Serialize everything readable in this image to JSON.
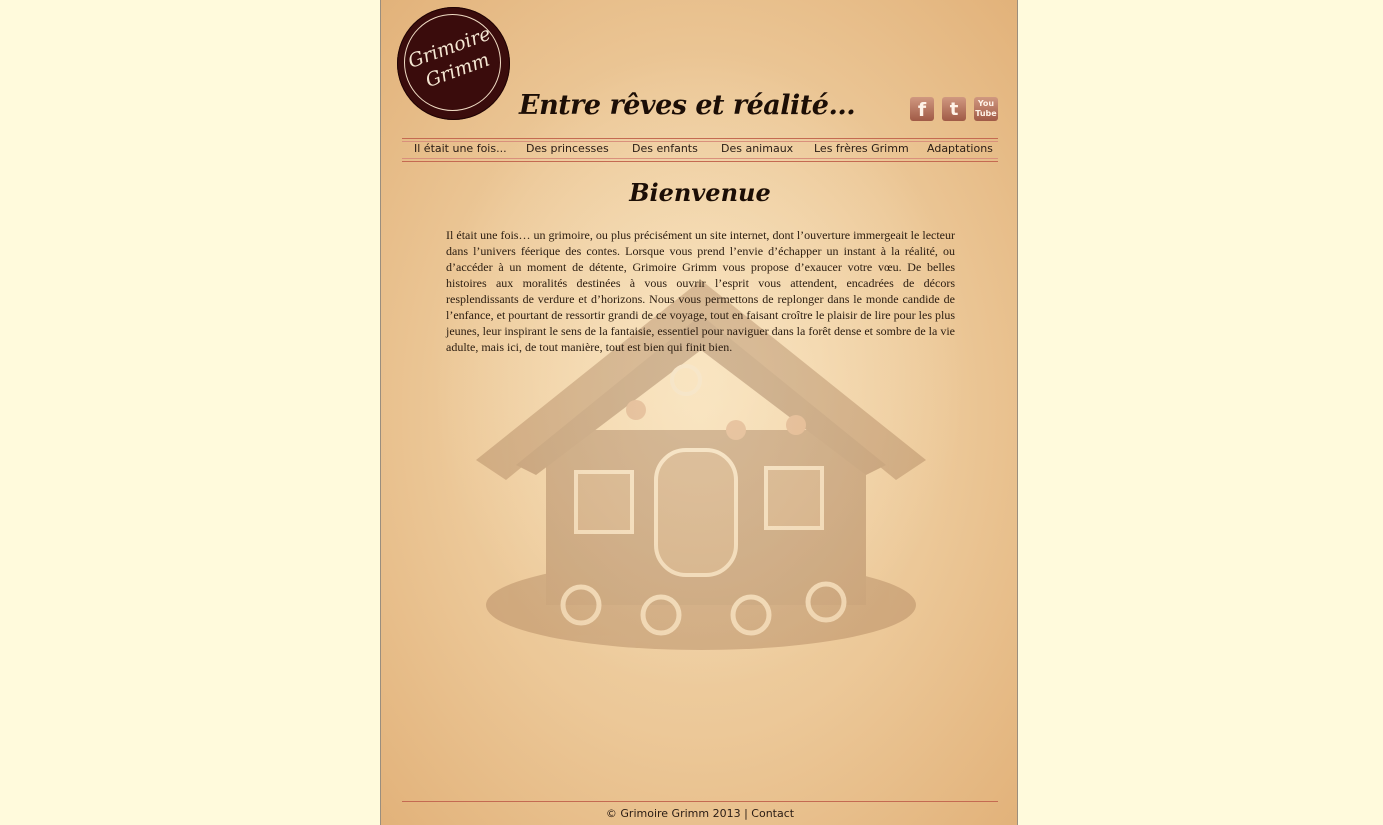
{
  "site": {
    "logo_line1": "Grimoire",
    "logo_line2": "Grimm",
    "tagline": "Entre rêves et réalité..."
  },
  "social": [
    {
      "icon": "facebook-icon",
      "label": "f"
    },
    {
      "icon": "twitter-icon",
      "label": "t"
    },
    {
      "icon": "youtube-icon",
      "label_top": "You",
      "label_bottom": "Tube"
    }
  ],
  "nav": [
    "Il était une fois...",
    "Des princesses",
    "Des enfants",
    "Des animaux",
    "Les frères Grimm",
    "Adaptations"
  ],
  "main": {
    "title": "Bienvenue",
    "text": "Il était une fois… un grimoire, ou plus précisément un site internet, dont l’ouverture immergeait le lecteur dans l’univers féerique des contes. Lorsque vous prend l’envie d’échapper un instant à la réalité, ou d’accéder à un moment de détente, Grimoire Grimm vous propose d’exaucer votre vœu. De belles histoires aux moralités destinées à vous ouvrir l’esprit vous attendent, encadrées de décors resplendissants de verdure et d’horizons. Nous vous permettons de replonger dans le monde candide de l’enfance, et pourtant de ressortir grandi de ce voyage, tout en faisant croître le plaisir de lire pour les plus jeunes, leur inspirant le sens de la fantaisie, essentiel pour naviguer dans la forêt dense et sombre de la vie adulte, mais ici, de tout manière, tout est bien qui finit bien."
  },
  "footer": {
    "copyright": "© Grimoire Grimm 2013",
    "separator": "|",
    "contact": "Contact"
  },
  "colors": {
    "outer_background": "#fffadc",
    "parchment": "#ecc898",
    "logo": "#3a0c0c",
    "rule": "#c46a52"
  }
}
